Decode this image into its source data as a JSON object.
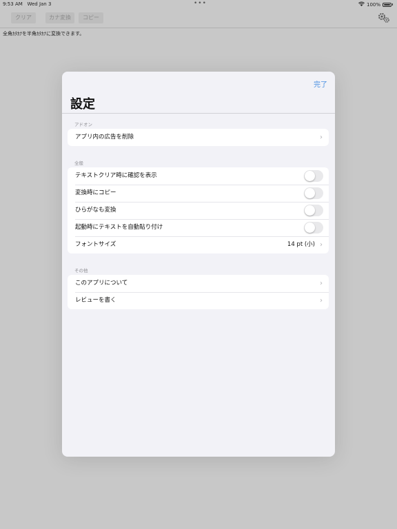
{
  "status_bar": {
    "time": "9:53 AM",
    "date": "Wed Jan 3",
    "dots": "•••",
    "battery_percent": "100%"
  },
  "toolbar": {
    "clear_label": "クリア",
    "kana_label": "カナ変換",
    "copy_label": "コピー",
    "settings_icon": "gears-icon"
  },
  "background": {
    "description_text": "全角ｶﾀｶﾅを半角ｶﾀｶﾅに変換できます。"
  },
  "modal": {
    "done_label": "完了",
    "title": "設定",
    "sections": {
      "addon": {
        "header": "アドオン",
        "rows": [
          {
            "label": "アプリ内の広告を削除",
            "control": "chevron"
          }
        ]
      },
      "general": {
        "header": "全般",
        "rows": [
          {
            "label": "テキストクリア時に確認を表示",
            "control": "toggle",
            "on": false
          },
          {
            "label": "変換時にコピー",
            "control": "toggle",
            "on": false
          },
          {
            "label": "ひらがなも変換",
            "control": "toggle",
            "on": false
          },
          {
            "label": "起動時にテキストを自動貼り付け",
            "control": "toggle",
            "on": false
          },
          {
            "label": "フォントサイズ",
            "control": "chevron",
            "value": "14 pt (小)"
          }
        ]
      },
      "other": {
        "header": "その他",
        "rows": [
          {
            "label": "このアプリについて",
            "control": "chevron"
          },
          {
            "label": "レビューを書く",
            "control": "chevron"
          }
        ]
      }
    }
  },
  "colors": {
    "accent": "#4a90e2",
    "backdrop": "#c8c8c8",
    "sheet_background": "#f2f2f7"
  }
}
